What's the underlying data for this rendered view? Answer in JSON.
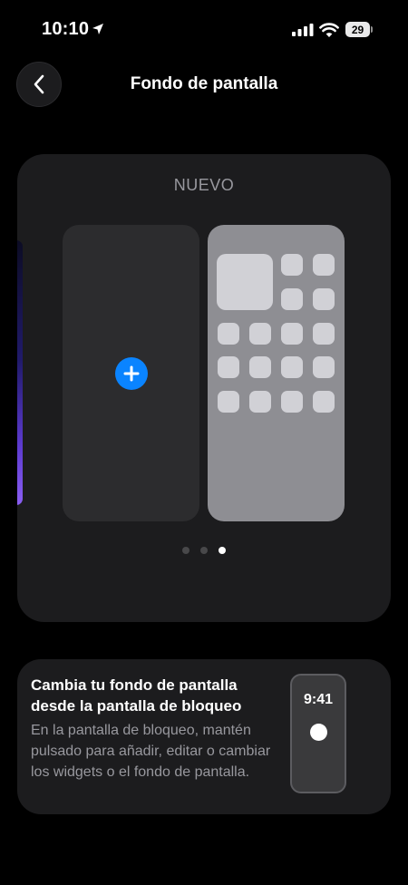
{
  "status_bar": {
    "time": "10:10",
    "battery_level": "29",
    "location_icon": "location-arrow-icon",
    "signal_icon": "cellular-signal-icon",
    "wifi_icon": "wifi-icon"
  },
  "nav": {
    "back_icon": "chevron-left-icon",
    "title": "Fondo de pantalla"
  },
  "wallpaper_gallery": {
    "label": "NUEVO",
    "add_icon": "plus-icon",
    "page_count": 3,
    "active_page": 3
  },
  "tip": {
    "title": "Cambia tu fondo de pantalla desde la pantalla de bloqueo",
    "body": "En la pantalla de bloqueo, mantén pulsado para añadir, editar o cambiar los widgets o el fondo de pantalla.",
    "preview_time": "9:41"
  },
  "colors": {
    "background": "#000000",
    "card": "#1c1c1e",
    "accent": "#0a84ff",
    "secondary_text": "#98989e"
  }
}
